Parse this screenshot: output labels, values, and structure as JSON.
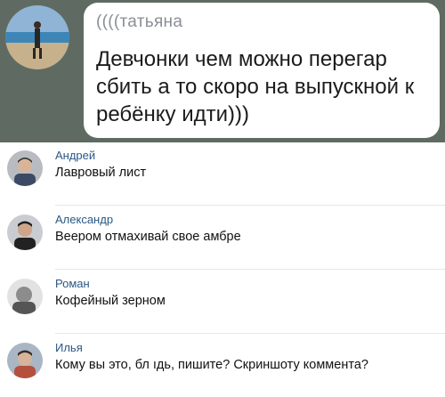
{
  "post": {
    "author": "((((татьяна",
    "text": "Девчонки чем можно перегар сбить а то скоро на выпускной к ребёнку идти)))"
  },
  "comments": [
    {
      "name": "Андрей",
      "text": "Лавровый лист"
    },
    {
      "name": "Александр",
      "text": "Веером отмахивай свое амбре"
    },
    {
      "name": "Роман",
      "text": "Кофейный зерном"
    },
    {
      "name": "Илья",
      "text": "Кому вы это, бл ıдь, пишите? Скриншоту коммента?"
    }
  ],
  "colors": {
    "header_bg": "#5f6b62",
    "name_link": "#2a5885",
    "text": "#111111"
  }
}
